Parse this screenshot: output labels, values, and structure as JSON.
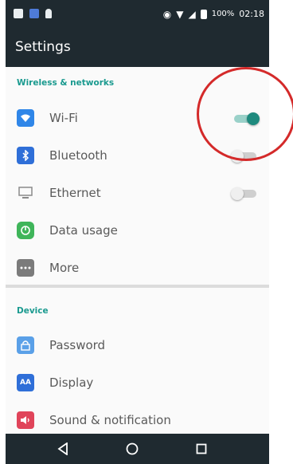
{
  "statusbar": {
    "battery": "100%",
    "time": "02:18"
  },
  "header": {
    "title": "Settings"
  },
  "sections": {
    "wireless": {
      "title": "Wireless & networks",
      "items": [
        {
          "label": "Wi-Fi",
          "icon": "wifi-icon",
          "toggle": "on"
        },
        {
          "label": "Bluetooth",
          "icon": "bluetooth-icon",
          "toggle": "off"
        },
        {
          "label": "Ethernet",
          "icon": "ethernet-icon",
          "toggle": "off"
        },
        {
          "label": "Data usage",
          "icon": "data-usage-icon"
        },
        {
          "label": "More",
          "icon": "more-icon"
        }
      ]
    },
    "device": {
      "title": "Device",
      "items": [
        {
          "label": "Password",
          "icon": "password-icon"
        },
        {
          "label": "Display",
          "icon": "display-icon",
          "icon_text": "AA"
        },
        {
          "label": "Sound & notification",
          "icon": "sound-icon"
        }
      ]
    }
  },
  "navbar": {
    "buttons": [
      "back-icon",
      "home-icon",
      "recents-icon"
    ]
  },
  "colors": {
    "bar": "#1f2a30",
    "accent": "#1a9a8f",
    "toggle_on": "#1e8a7e",
    "annotation": "#d42a2a"
  }
}
